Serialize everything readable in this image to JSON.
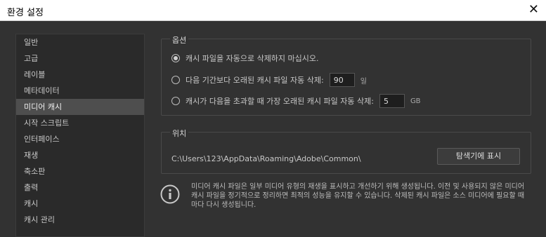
{
  "window": {
    "title": "환경 설정",
    "close_glyph": "✕"
  },
  "sidebar": {
    "items": [
      {
        "label": "일반"
      },
      {
        "label": "고급"
      },
      {
        "label": "레이블"
      },
      {
        "label": "메타데이터"
      },
      {
        "label": "미디어 캐시",
        "selected": true
      },
      {
        "label": "시작 스크립트"
      },
      {
        "label": "인터페이스"
      },
      {
        "label": "재생"
      },
      {
        "label": "축소판"
      },
      {
        "label": "출력"
      },
      {
        "label": "캐시"
      },
      {
        "label": "캐시 관리"
      }
    ]
  },
  "options": {
    "legend": "옵션",
    "radio1_label": "캐시 파일을 자동으로 삭제하지 마십시오.",
    "radio2_label": "다음 기간보다 오래된 캐시 파일 자동 삭제:",
    "radio2_value": "90",
    "radio2_unit": "일",
    "radio3_label": "캐시가 다음을 초과할 때 가장 오래된 캐시 파일 자동 삭제:",
    "radio3_value": "5",
    "radio3_unit": "GB",
    "selected": 1
  },
  "location": {
    "legend": "위치",
    "path": "C:\\Users\\123\\AppData\\Roaming\\Adobe\\Common\\",
    "reveal_button": "탐색기에 표시"
  },
  "info": {
    "icon": "info-icon",
    "text": "미디어 캐시 파일은 일부 미디어 유형의 재생을 표시하고 개선하기 위해 생성됩니다. 이전 및 사용되지 않은 미디어 캐시 파일을 정기적으로 정리하면 최적의 성능을 유지할 수 있습니다. 삭제된 캐시 파일은 소스 미디어에 필요할 때마다 다시 생성됩니다."
  },
  "colors": {
    "background": "#323232",
    "sidebar_bg": "#2a2a2a",
    "selected_bg": "#4e4e4e"
  }
}
